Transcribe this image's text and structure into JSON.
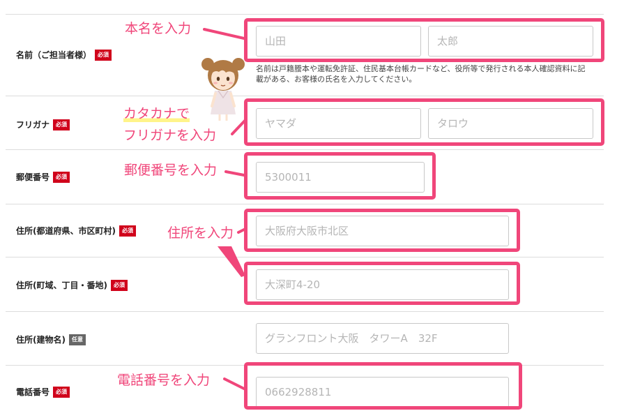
{
  "rows": {
    "name": {
      "label": "名前（ご担当者様）",
      "badge": "必須",
      "last_placeholder": "山田",
      "first_placeholder": "太郎",
      "help": "名前は戸籍謄本や運転免許証、住民基本台帳カードなど、役所等で発行される本人確認資料に記載がある、お客様の氏名を入力してください。"
    },
    "furigana": {
      "label": "フリガナ",
      "badge": "必須",
      "last_placeholder": "ヤマダ",
      "first_placeholder": "タロウ"
    },
    "postal": {
      "label": "郵便番号",
      "badge": "必須",
      "placeholder": "5300011"
    },
    "address1": {
      "label": "住所(都道府県、市区町村)",
      "badge": "必須",
      "placeholder": "大阪府大阪市北区"
    },
    "address2": {
      "label": "住所(町域、丁目・番地)",
      "badge": "必須",
      "placeholder": "大深町4-20"
    },
    "building": {
      "label": "住所(建物名)",
      "badge": "任意",
      "placeholder": "グランフロント大阪　タワーA　32F"
    },
    "phone": {
      "label": "電話番号",
      "badge": "必須",
      "placeholder": "0662928811"
    }
  },
  "annotations": {
    "name": "本名を入力",
    "furigana_line1": "カタカナで",
    "furigana_line2": "フリガナを入力",
    "postal": "郵便番号を入力",
    "address": "住所を入力",
    "phone": "電話番号を入力"
  },
  "colors": {
    "highlight": "#f0467a",
    "required_badge": "#d0021b",
    "optional_badge": "#666666",
    "marker": "#fff48a"
  }
}
